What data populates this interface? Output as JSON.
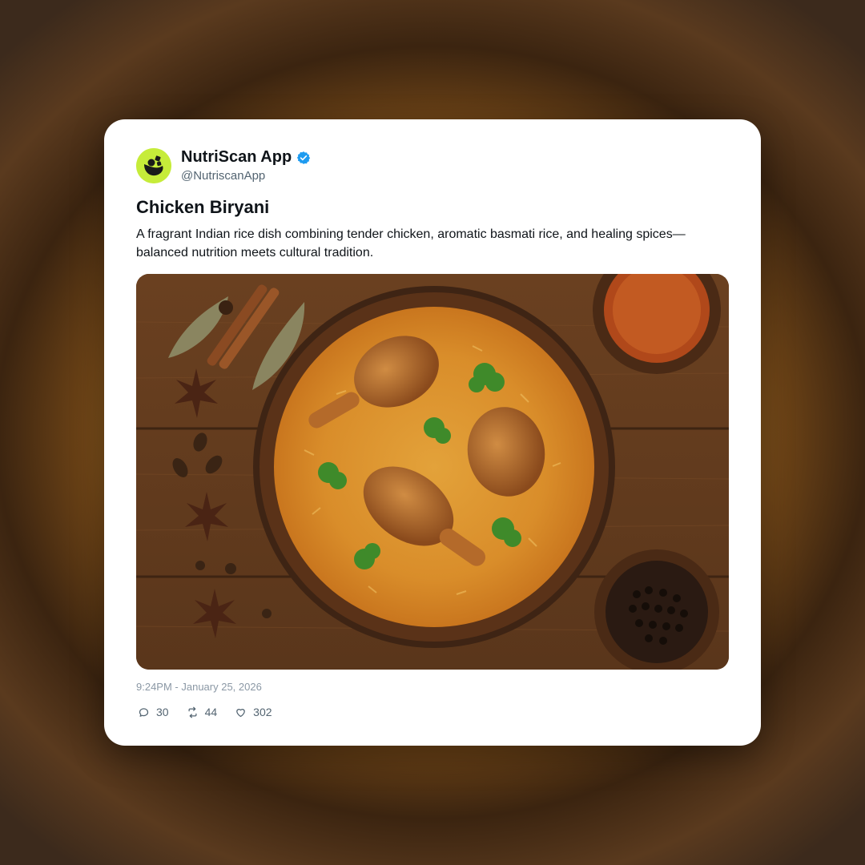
{
  "post": {
    "author_name": "NutriScan App",
    "author_handle": "@NutriscanApp",
    "verified": true,
    "title": "Chicken Biryani",
    "description": "A fragrant Indian rice dish combining tender chicken, aromatic basmati rice, and healing spices—balanced nutrition meets cultural tradition.",
    "timestamp": "9:24PM - January 25, 2026",
    "stats": {
      "replies": "30",
      "reposts": "44",
      "likes": "302"
    }
  },
  "icons": {
    "avatar": "nutriscan-logo-icon",
    "verified": "verified-badge-icon",
    "reply": "reply-icon",
    "repost": "repost-icon",
    "like": "heart-icon"
  },
  "colors": {
    "avatar_bg": "#c6ec3a",
    "verified": "#1d9bf0",
    "card_bg": "#ffffff",
    "muted_text": "#536471"
  }
}
